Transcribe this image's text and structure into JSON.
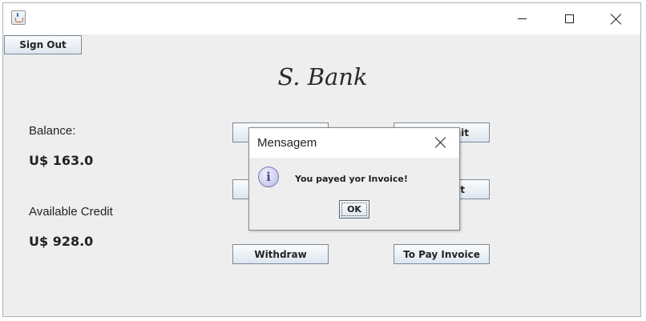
{
  "window": {
    "icon": "java-cup-icon",
    "controls": [
      "minimize-icon",
      "maximize-icon",
      "close-icon"
    ]
  },
  "toolbar": {
    "sign_out_label": "Sign Out"
  },
  "header": {
    "title": "S. Bank"
  },
  "account": {
    "balance_label": "Balance:",
    "balance_value": "U$ 163.0",
    "credit_label": "Available Credit",
    "credit_value": "U$ 928.0"
  },
  "actions": {
    "deposit_label_partial": "nit",
    "payment_label_partial": "nt",
    "withdraw_label": "Withdraw",
    "pay_invoice_label": "To Pay Invoice"
  },
  "dialog": {
    "title": "Mensagem",
    "icon": "info-icon",
    "message": "You payed yor Invoice!",
    "ok_label": "OK"
  }
}
